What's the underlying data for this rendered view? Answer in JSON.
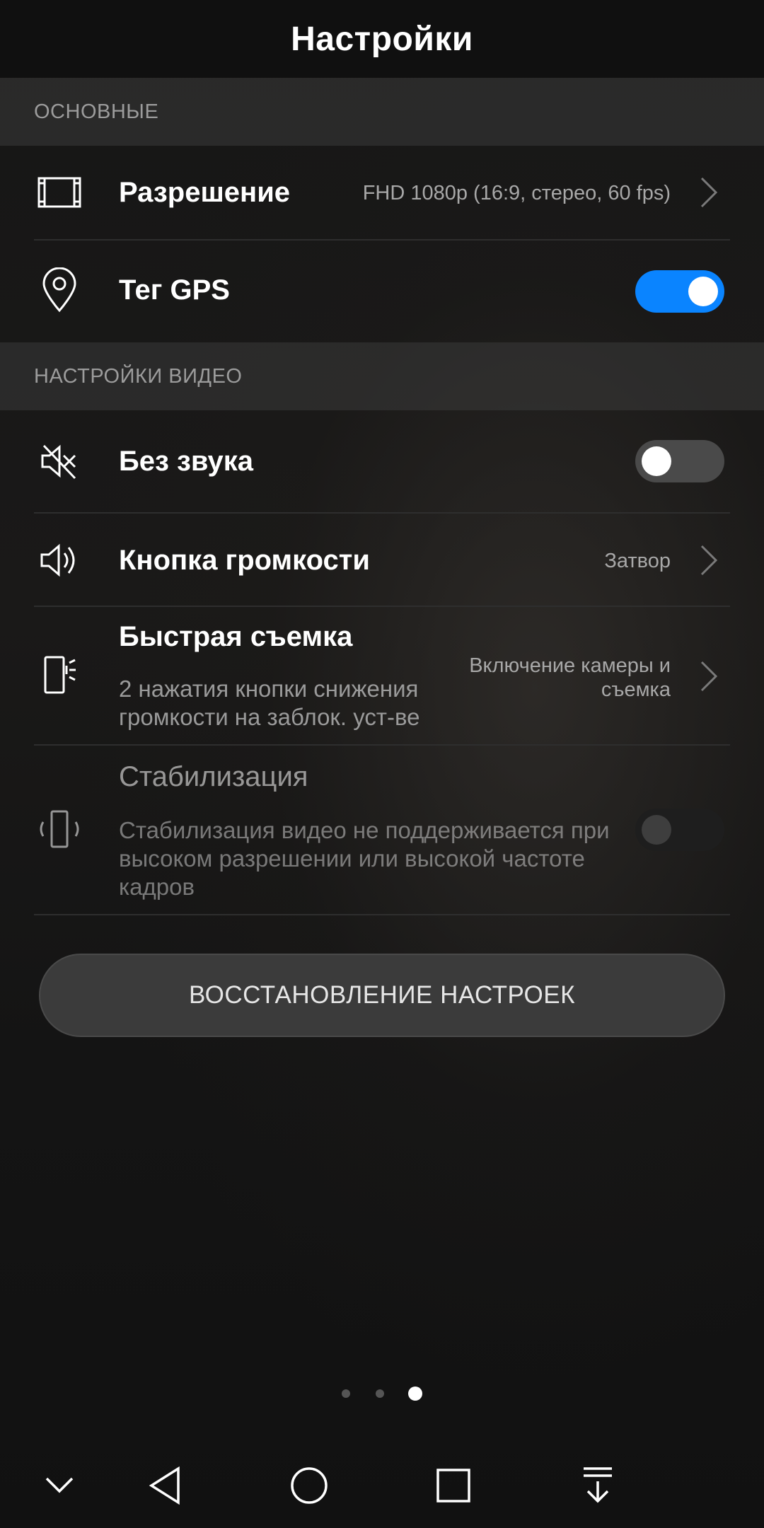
{
  "header": {
    "title": "Настройки"
  },
  "sections": {
    "basic": "ОСНОВНЫЕ",
    "video": "НАСТРОЙКИ ВИДЕО"
  },
  "rows": {
    "resolution": {
      "label": "Разрешение",
      "value": "FHD 1080p (16:9, стерео, 60 fps)",
      "icon": "film-frame-icon"
    },
    "gps": {
      "label": "Тег GPS",
      "toggle": true,
      "icon": "location-pin-icon"
    },
    "mute": {
      "label": "Без звука",
      "toggle": false,
      "icon": "speaker-muted-icon"
    },
    "volume_key": {
      "label": "Кнопка громкости",
      "value": "Затвор",
      "icon": "speaker-icon"
    },
    "quick_shot": {
      "label": "Быстрая съемка",
      "sub_line1": "2 нажатия кнопки снижения",
      "sub_line2": "громкости на заблок. уст-ве",
      "value_line1": "Включение камеры и",
      "value_line2": "съемка",
      "icon": "phone-side-button-icon"
    },
    "stabilization": {
      "label": "Стабилизация",
      "sub_line1": "Стабилизация видео не поддерживается при",
      "sub_line2": "высоком разрешении или высокой частоте",
      "sub_line3": "кадров",
      "toggle": false,
      "disabled": true,
      "icon": "phone-stabilization-icon"
    }
  },
  "reset_button": {
    "label": "ВОССТАНОВЛЕНИЕ НАСТРОЕК"
  },
  "pager": {
    "count": 3,
    "active_index": 2
  },
  "navbar": {
    "items": [
      "chevron-down-icon",
      "back-triangle-icon",
      "home-circle-icon",
      "recents-square-icon",
      "notification-pulldown-icon"
    ]
  },
  "colors": {
    "accent": "#0a84ff",
    "background": "#141414",
    "section_bg": "#2a2a2a"
  }
}
